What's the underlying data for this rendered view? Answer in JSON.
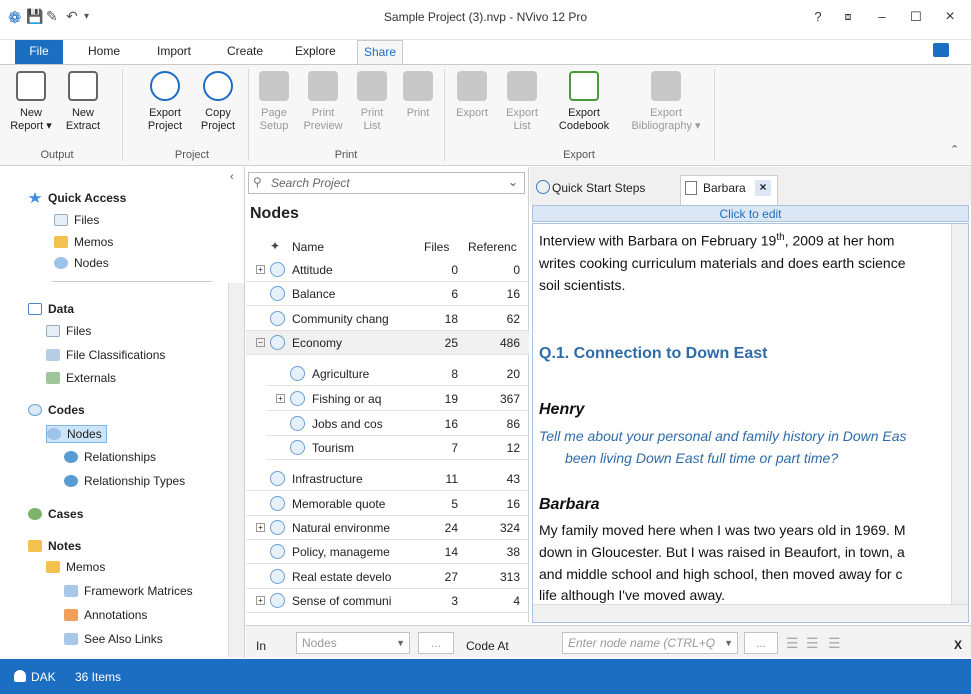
{
  "window": {
    "title": "Sample Project (3).nvp - NVivo 12 Pro",
    "help": "?",
    "restore": "⧈",
    "min": "–",
    "max": "☐",
    "close": "×"
  },
  "tabs": [
    "File",
    "Home",
    "Import",
    "Create",
    "Explore",
    "Share"
  ],
  "ribbon": {
    "new_report": [
      "New",
      "Report ▾"
    ],
    "new_extract": [
      "New",
      "Extract"
    ],
    "export_project": [
      "Export",
      "Project"
    ],
    "copy_project": [
      "Copy",
      "Project"
    ],
    "page_setup": [
      "Page",
      "Setup"
    ],
    "print_preview": [
      "Print",
      "Preview"
    ],
    "print_list": [
      "Print",
      "List"
    ],
    "print": "Print",
    "export": "Export",
    "export_list": [
      "Export",
      "List"
    ],
    "export_codebook": [
      "Export",
      "Codebook"
    ],
    "export_bibliography": [
      "Export",
      "Bibliography ▾"
    ],
    "groups": {
      "output": "Output",
      "project": "Project",
      "print": "Print",
      "export": "Export"
    }
  },
  "nav": {
    "quick_access": "Quick Access",
    "qa_files": "Files",
    "qa_memos": "Memos",
    "qa_nodes": "Nodes",
    "data": "Data",
    "data_files": "Files",
    "data_fileclass": "File Classifications",
    "data_externals": "Externals",
    "codes": "Codes",
    "codes_nodes": "Nodes",
    "codes_rel": "Relationships",
    "codes_reltypes": "Relationship Types",
    "cases": "Cases",
    "notes": "Notes",
    "notes_memos": "Memos",
    "notes_fm": "Framework Matrices",
    "notes_ann": "Annotations",
    "notes_sal": "See Also Links"
  },
  "list": {
    "search_placeholder": "Search Project",
    "title": "Nodes",
    "col_name": "Name",
    "col_files": "Files",
    "col_refs": "Referenc",
    "rows": [
      {
        "name": "Attitude",
        "files": "0",
        "refs": "0"
      },
      {
        "name": "Balance",
        "files": "6",
        "refs": "16"
      },
      {
        "name": "Community chang",
        "files": "18",
        "refs": "62"
      },
      {
        "name": "Economy",
        "files": "25",
        "refs": "486"
      },
      {
        "name": "Agriculture",
        "files": "8",
        "refs": "20"
      },
      {
        "name": "Fishing or aq",
        "files": "19",
        "refs": "367"
      },
      {
        "name": "Jobs and cos",
        "files": "16",
        "refs": "86"
      },
      {
        "name": "Tourism",
        "files": "7",
        "refs": "12"
      },
      {
        "name": "Infrastructure",
        "files": "11",
        "refs": "43"
      },
      {
        "name": "Memorable quote",
        "files": "5",
        "refs": "16"
      },
      {
        "name": "Natural environme",
        "files": "24",
        "refs": "324"
      },
      {
        "name": "Policy, manageme",
        "files": "14",
        "refs": "38"
      },
      {
        "name": "Real estate develo",
        "files": "27",
        "refs": "313"
      },
      {
        "name": "Sense of communi",
        "files": "3",
        "refs": "4"
      }
    ]
  },
  "detail": {
    "tab_qs": "Quick Start Steps",
    "tab_barbara": "Barbara",
    "click_to_edit": "Click to edit",
    "lines": [
      "Interview with Barbara on February 19th, 2009 at her hom",
      "writes cooking curriculum materials and does earth science",
      "soil scientists.",
      "Q.1. Connection to Down East",
      "Henry",
      "Tell me about your personal and family history in Down Eas",
      "been living Down East full time or part time?",
      "Barbara",
      "My family moved here when I was two years old in 1969. M",
      "down in Gloucester. But I was raised in Beaufort, in town, a",
      "and middle school and high school, then moved away for c",
      "life although I've moved away."
    ]
  },
  "bottom": {
    "in": "In",
    "nodes": "Nodes",
    "ellipsis": "...",
    "code_at": "Code At",
    "node_placeholder": "Enter node name (CTRL+Q",
    "x": "X"
  },
  "status": {
    "user": "DAK",
    "items": "36 Items"
  }
}
